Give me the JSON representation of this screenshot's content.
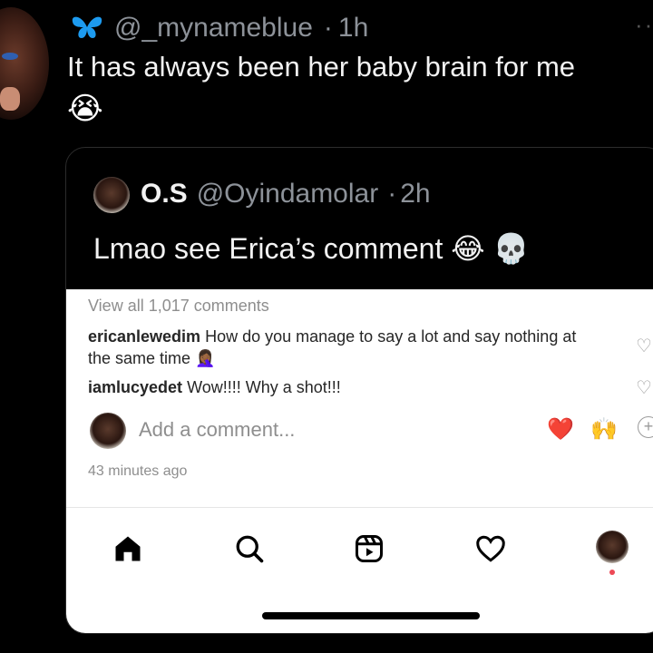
{
  "tweet": {
    "username": "@_mynameblue",
    "separator": "·",
    "time": "1h",
    "text": "It has always been her baby brain for me",
    "emoji": "😭",
    "badge_icon": "butterfly-icon",
    "menu": "···"
  },
  "quote": {
    "name": "O.S",
    "handle": "@Oyindamolar",
    "separator": "·",
    "time": "2h",
    "text": "Lmao see Erica’s comment",
    "emojis": [
      "😂",
      "💀"
    ]
  },
  "instagram": {
    "view_all": "View all 1,017 comments",
    "comments": [
      {
        "user": "ericanlewedim",
        "text": "How do you manage to say a lot and say nothing at the same time",
        "emoji": "🤦🏾‍♀️"
      },
      {
        "user": "iamlucyedet",
        "text": "Wow!!!! Why a shot!!!",
        "emoji": ""
      }
    ],
    "add_comment_placeholder": "Add a comment...",
    "reactions": [
      "❤️",
      "🙌"
    ],
    "timestamp": "43 minutes ago",
    "nav": [
      "home-icon",
      "search-icon",
      "reels-icon",
      "heart-icon",
      "profile-avatar"
    ],
    "notification_dot_color": "#ed4956"
  }
}
